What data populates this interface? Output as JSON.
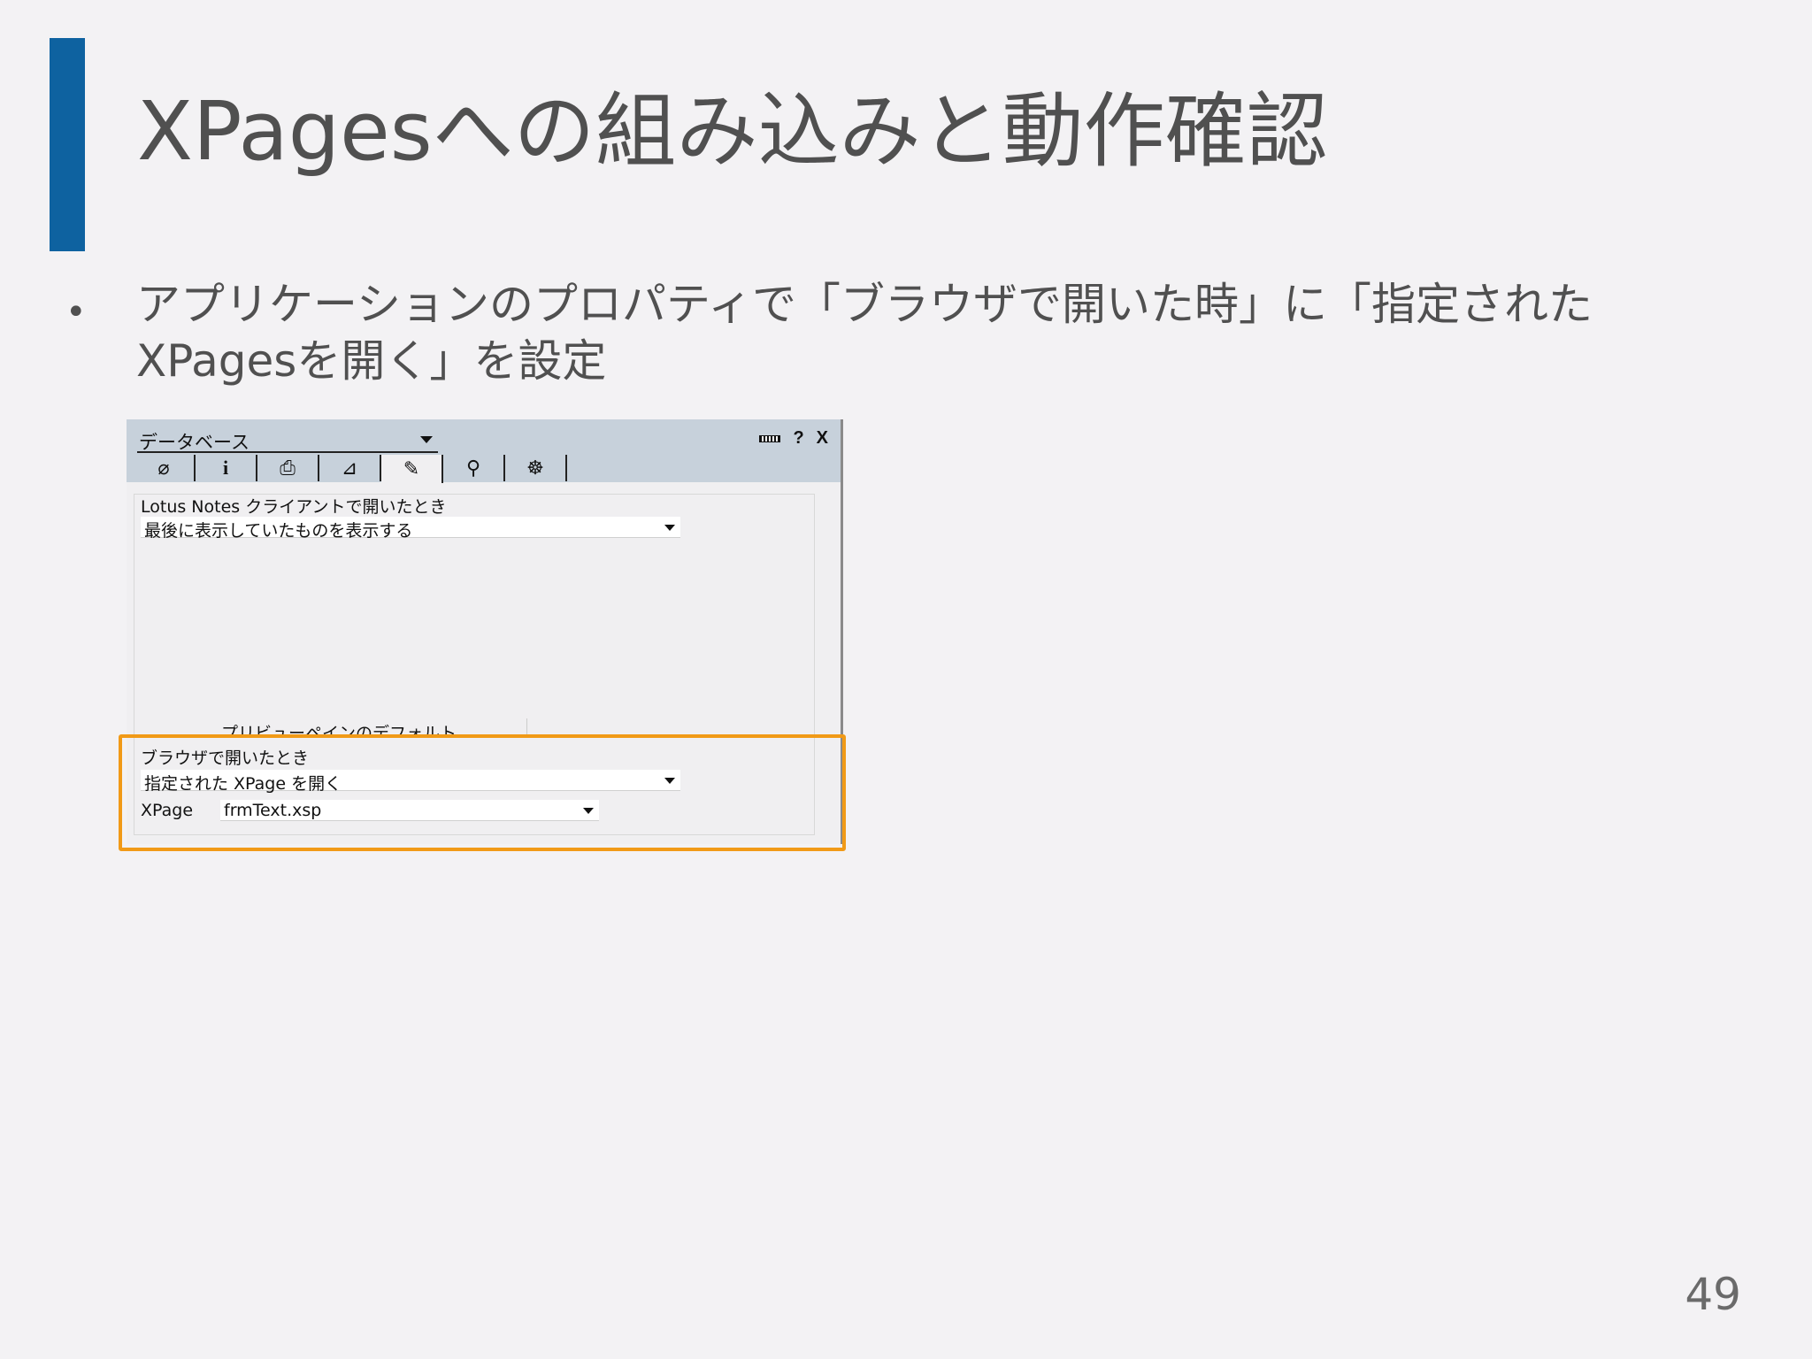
{
  "slide": {
    "title": "XPagesへの組み込みと動作確認",
    "bullet": "アプリケーションのプロパティで「ブラウザで開いた時」に「指定された XPagesを開く」を設定",
    "page_number": "49"
  },
  "colors": {
    "accent_bar": "#0e62a0",
    "highlight_border": "#f19a17"
  },
  "panel": {
    "db_dropdown_label": "データベース",
    "header_buttons": [
      "minimize-icon",
      "?",
      "X"
    ],
    "tabs": [
      {
        "icon": "basics-icon",
        "glyph": "⌀"
      },
      {
        "icon": "info-icon",
        "glyph": "i"
      },
      {
        "icon": "print-icon",
        "glyph": "⎙"
      },
      {
        "icon": "design-icon",
        "glyph": "⊿"
      },
      {
        "icon": "launch-icon",
        "glyph": "✎"
      },
      {
        "icon": "search-icon",
        "glyph": "⚲"
      },
      {
        "icon": "advanced-icon",
        "glyph": "☸"
      }
    ],
    "notes_client_label": "Lotus Notes クライアントで開いたとき",
    "notes_client_value": "最後に表示していたものを表示する",
    "preview_pane_label": "プリビューペインのデフォルト",
    "browser_label": "ブラウザで開いたとき",
    "browser_value": "指定された XPage を開く",
    "xpage_label": "XPage",
    "xpage_value": "frmText.xsp"
  }
}
